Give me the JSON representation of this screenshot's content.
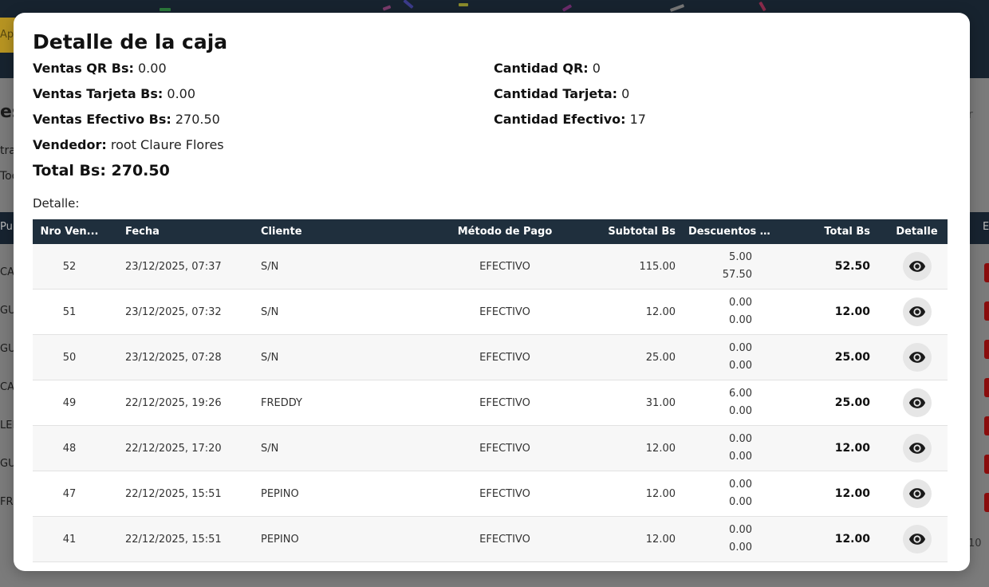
{
  "modal": {
    "title": "Detalle de la caja",
    "stats_left": [
      {
        "label": "Ventas QR Bs:",
        "value": "0.00"
      },
      {
        "label": "Ventas Tarjeta Bs:",
        "value": "0.00"
      },
      {
        "label": "Ventas Efectivo Bs:",
        "value": "270.50"
      },
      {
        "label": "Vendedor:",
        "value": "root Claure Flores"
      }
    ],
    "stats_right": [
      {
        "label": "Cantidad QR:",
        "value": "0"
      },
      {
        "label": "Cantidad Tarjeta:",
        "value": "0"
      },
      {
        "label": "Cantidad Efectivo:",
        "value": "17"
      }
    ],
    "total": "Total Bs: 270.50",
    "detail_label": "Detalle:",
    "table": {
      "headers": [
        "Nro Ven...",
        "Fecha",
        "Cliente",
        "Método de Pago",
        "Subtotal Bs",
        "Descuentos Bs",
        "Total Bs",
        "Detalle"
      ],
      "rows": [
        {
          "nro": "52",
          "fecha": "23/12/2025, 07:37",
          "cliente": "S/N",
          "metodo": "EFECTIVO",
          "subtotal": "115.00",
          "descuento": "5.00",
          "descuento2": "57.50",
          "total": "52.50"
        },
        {
          "nro": "51",
          "fecha": "23/12/2025, 07:32",
          "cliente": "S/N",
          "metodo": "EFECTIVO",
          "subtotal": "12.00",
          "descuento": "0.00",
          "descuento2": "0.00",
          "total": "12.00"
        },
        {
          "nro": "50",
          "fecha": "23/12/2025, 07:28",
          "cliente": "S/N",
          "metodo": "EFECTIVO",
          "subtotal": "25.00",
          "descuento": "0.00",
          "descuento2": "0.00",
          "total": "25.00"
        },
        {
          "nro": "49",
          "fecha": "22/12/2025, 19:26",
          "cliente": "FREDDY",
          "metodo": "EFECTIVO",
          "subtotal": "31.00",
          "descuento": "6.00",
          "descuento2": "0.00",
          "total": "25.00"
        },
        {
          "nro": "48",
          "fecha": "22/12/2025, 17:20",
          "cliente": "S/N",
          "metodo": "EFECTIVO",
          "subtotal": "12.00",
          "descuento": "0.00",
          "descuento2": "0.00",
          "total": "12.00"
        },
        {
          "nro": "47",
          "fecha": "22/12/2025, 15:51",
          "cliente": "PEPINO",
          "metodo": "EFECTIVO",
          "subtotal": "12.00",
          "descuento": "0.00",
          "descuento2": "0.00",
          "total": "12.00"
        },
        {
          "nro": "41",
          "fecha": "22/12/2025, 15:51",
          "cliente": "PEPINO",
          "metodo": "EFECTIVO",
          "subtotal": "12.00",
          "descuento": "0.00",
          "descuento2": "0.00",
          "total": "12.00"
        }
      ],
      "detail_icon": "eye-icon"
    }
  },
  "background": {
    "button_text": "Ape",
    "heading_fragment": "es",
    "filter_label_fragment": "tra",
    "filter_value_fragment": "Tod",
    "header_fragment": "Pu",
    "header_right_fragment": "E",
    "search_fragment": "r",
    "row_fragments": [
      "CA",
      "GU",
      "GU",
      "CA",
      "LEN",
      "GU",
      "FRE"
    ],
    "pagination_fragment": "10"
  },
  "colors": {
    "table_header": "#1f2f3d",
    "app_header": "#17232f",
    "action_red": "#8a0d0d"
  }
}
